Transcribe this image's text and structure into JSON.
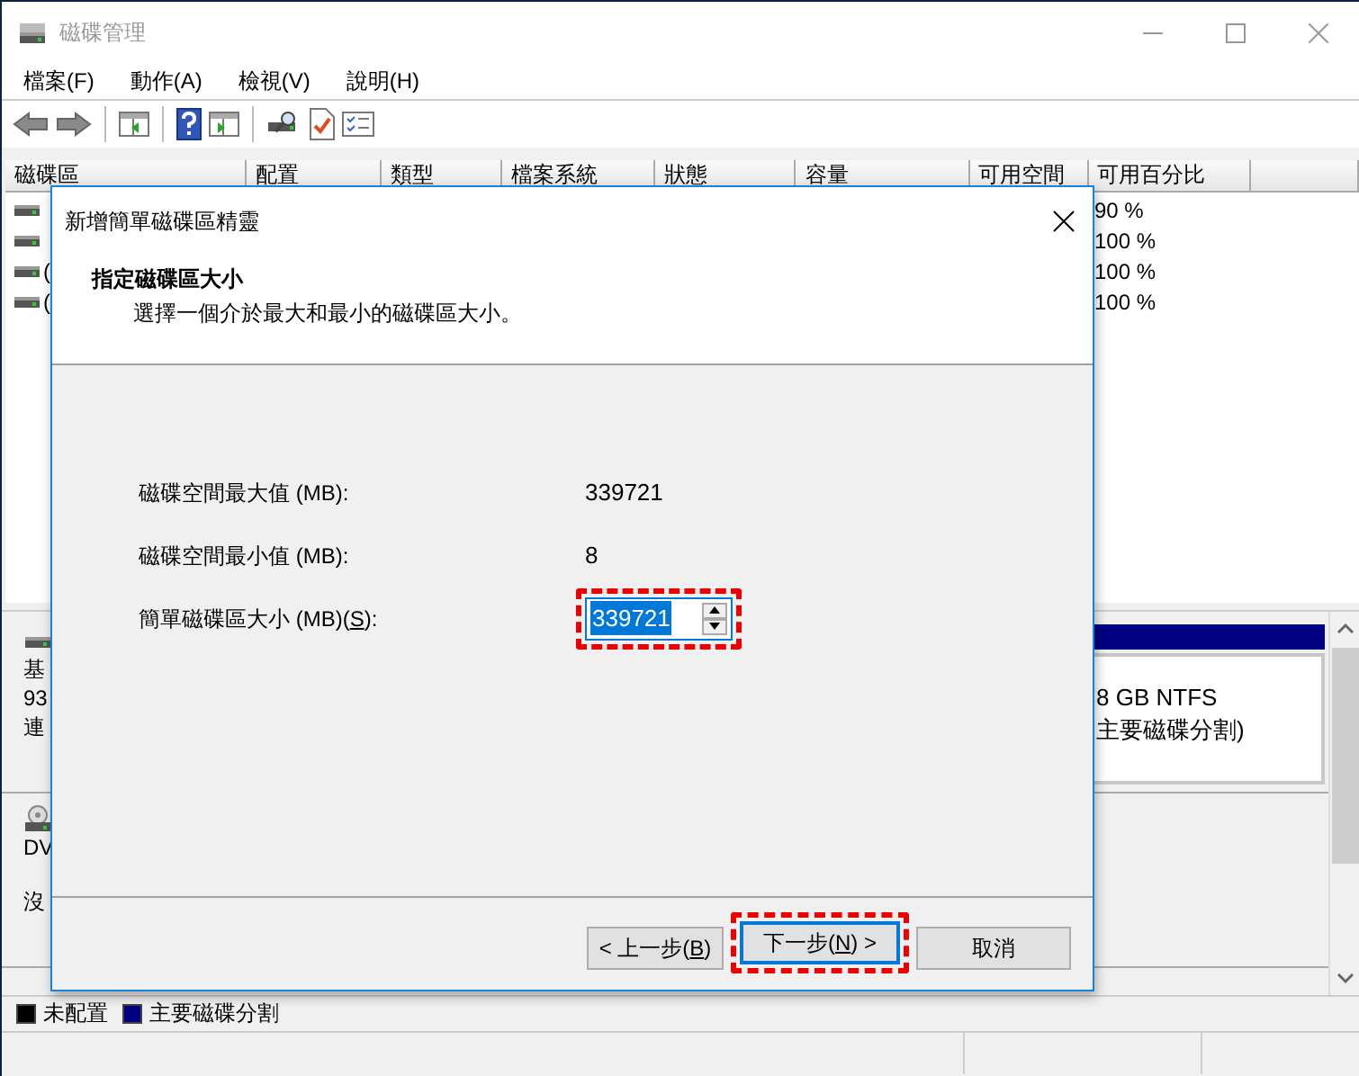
{
  "window": {
    "title": "磁碟管理"
  },
  "menu": [
    {
      "label": "檔案(F)"
    },
    {
      "label": "動作(A)"
    },
    {
      "label": "檢視(V)"
    },
    {
      "label": "說明(H)"
    }
  ],
  "volume_table": {
    "columns": [
      "磁碟區",
      "配置",
      "類型",
      "檔案系統",
      "狀態",
      "容量",
      "可用空間",
      "可用百分比"
    ],
    "rows": [
      {
        "free_percent": "90 %"
      },
      {
        "free_percent": "100 %"
      },
      {
        "volume": "(",
        "free_percent": "100 %"
      },
      {
        "volume": "(",
        "free_percent": "100 %"
      }
    ]
  },
  "disks": [
    {
      "kind": "hdd",
      "label_lines": [
        "基",
        "93",
        "連"
      ],
      "partition": {
        "lines": [
          "8 GB NTFS",
          "主要磁碟分割)"
        ]
      }
    },
    {
      "kind": "dvd",
      "label_lines": [
        "DV",
        "沒"
      ]
    }
  ],
  "legend": [
    {
      "label": "未配置",
      "color": "#000000"
    },
    {
      "label": "主要磁碟分割",
      "color": "#000080"
    }
  ],
  "dialog": {
    "title": "新增簡單磁碟區精靈",
    "heading": "指定磁碟區大小",
    "subtitle": "選擇一個介於最大和最小的磁碟區大小。",
    "fields": [
      {
        "kind": "readout",
        "label": "磁碟空間最大值 (MB):",
        "value": "339721"
      },
      {
        "kind": "readout",
        "label": "磁碟空間最小值 (MB):",
        "value": "8"
      },
      {
        "kind": "spinner",
        "label": "簡單磁碟區大小 (MB)(",
        "access_key": "S",
        "label_end": "):",
        "value": "339721",
        "value_selected": true,
        "highlighted": true
      }
    ],
    "buttons": [
      {
        "label": "< 上一步(",
        "access_key": "B",
        "label_end": ")",
        "focused": false,
        "highlighted": false
      },
      {
        "label": "下一步(",
        "access_key": "N",
        "label_end": ") >",
        "focused": true,
        "highlighted": true
      },
      {
        "label": "取消",
        "focused": false,
        "highlighted": false
      }
    ]
  }
}
